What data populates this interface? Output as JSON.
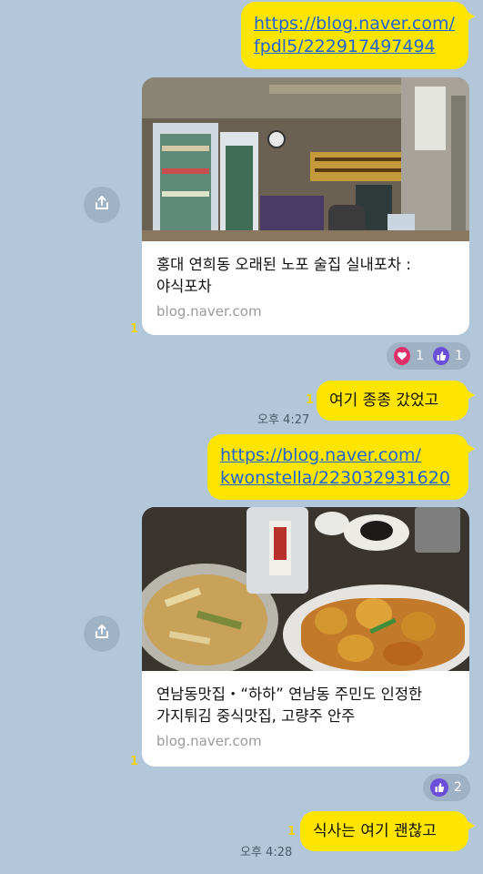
{
  "messages": {
    "link1": {
      "line1": "https://blog.naver.com/",
      "line2": "fpdl5/222917497494"
    },
    "card1": {
      "title_line1": "홍대 연희동 오래된 노포 술집 실내포차 :",
      "title_line2": "야식포차",
      "domain": "blog.naver.com",
      "unread": "1"
    },
    "reactions1": {
      "heart_count": "1",
      "like_count": "1"
    },
    "msg1": {
      "text": "여기 종종 갔었고",
      "unread": "1",
      "time": "오후 4:27"
    },
    "link2": {
      "line1": "https://blog.naver.com/",
      "line2": "kwonstella/223032931620"
    },
    "card2": {
      "title_line1": "연남동맛집・“하하” 연남동 주민도 인정한",
      "title_line2": "가지튀김 중식맛집, 고량주 안주",
      "domain": "blog.naver.com",
      "unread": "1"
    },
    "reactions2": {
      "like_count": "2"
    },
    "msg2": {
      "text": "식사는 여기 괜찮고",
      "unread": "1",
      "time": "오후 4:28"
    }
  },
  "icons": {
    "share": "share-icon",
    "heart": "heart-icon",
    "like": "thumbs-up-icon"
  },
  "colors": {
    "background": "#b2c7d9",
    "bubble": "#fee500",
    "link": "#1f64d6",
    "heart": "#e0306a",
    "like": "#6b4fd8"
  }
}
